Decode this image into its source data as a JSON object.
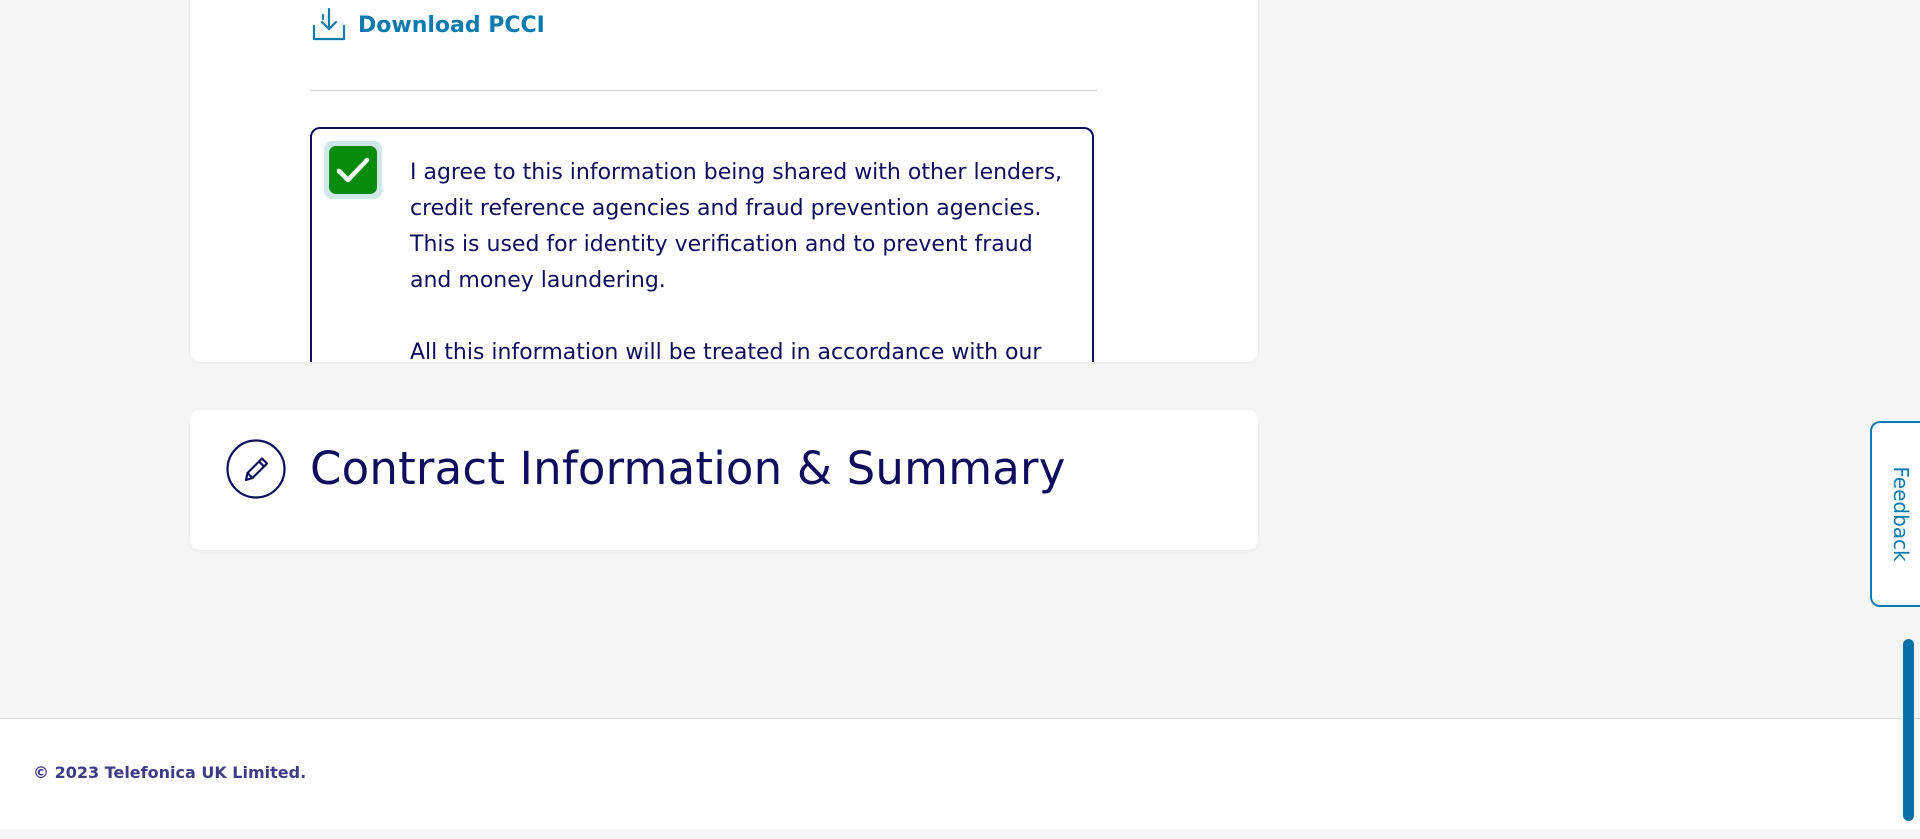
{
  "download": {
    "label": "Download PCCI",
    "icon": "download-icon"
  },
  "consent": {
    "checked": true,
    "checkbox_color": "#068b0b",
    "paragraph_1": "I agree to this information being shared with other lenders, credit reference agencies and fraud prevention agencies. This is used for identity verification and to prevent fraud and money laundering.",
    "paragraph_2": "All this information will be treated in accordance with our"
  },
  "contract_section": {
    "title": "Contract Information & Summary",
    "icon": "pencil-icon"
  },
  "feedback": {
    "label": "Feedback"
  },
  "footer": {
    "copyright": "© 2023 Telefonica UK Limited."
  },
  "colors": {
    "navy": "#0f0d5c",
    "link_blue": "#0a7bac",
    "background": "#f6f6f6"
  }
}
